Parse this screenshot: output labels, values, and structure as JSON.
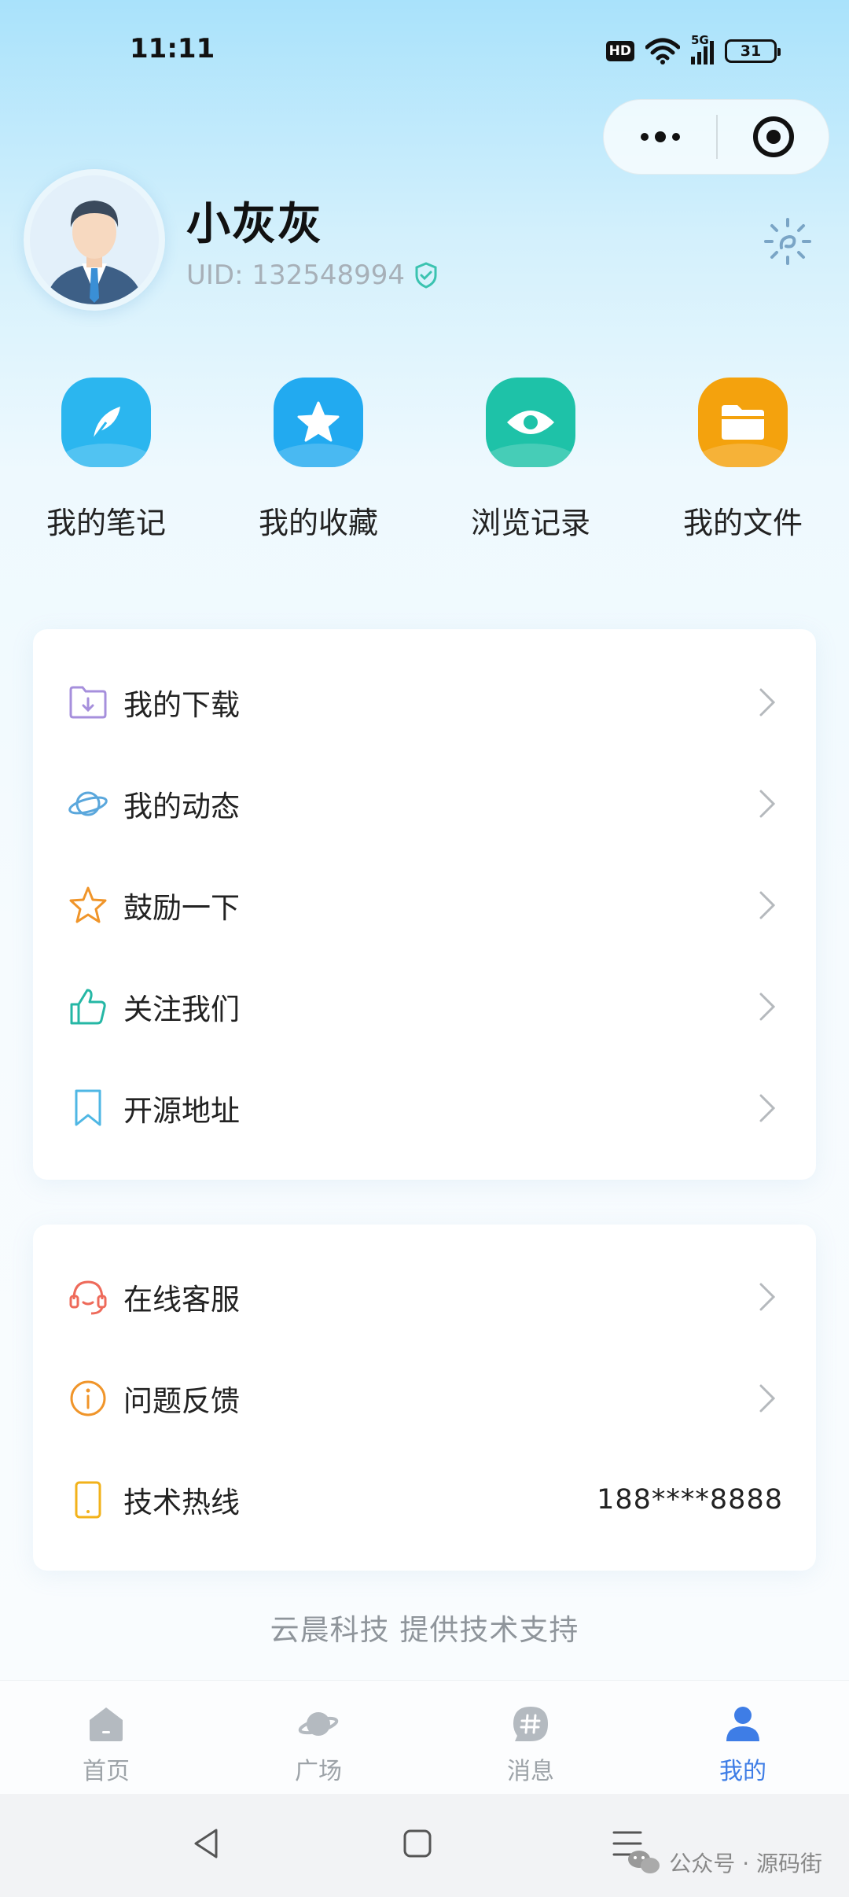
{
  "status_bar": {
    "time": "11:11",
    "hd": "HD",
    "network": "5G",
    "battery": "31"
  },
  "profile": {
    "name": "小灰灰",
    "uid": "UID: 132548994"
  },
  "quick_actions": [
    {
      "label": "我的笔记",
      "icon": "feather-icon",
      "color": "#2bb6ef"
    },
    {
      "label": "我的收藏",
      "icon": "star-icon",
      "color": "#22aaf0"
    },
    {
      "label": "浏览记录",
      "icon": "eye-icon",
      "color": "#1ec2a8"
    },
    {
      "label": "我的文件",
      "icon": "folder-icon",
      "color": "#f4a20d"
    }
  ],
  "menu_group1": [
    {
      "label": "我的下载",
      "icon": "download-folder-icon",
      "color": "#a68fdc"
    },
    {
      "label": "我的动态",
      "icon": "planet-icon",
      "color": "#5aa7dc"
    },
    {
      "label": "鼓励一下",
      "icon": "star-outline-icon",
      "color": "#f0952a"
    },
    {
      "label": "关注我们",
      "icon": "thumbs-up-icon",
      "color": "#25b7a5"
    },
    {
      "label": "开源地址",
      "icon": "bookmark-icon",
      "color": "#4fb7e4"
    }
  ],
  "menu_group2": [
    {
      "label": "在线客服",
      "icon": "headset-icon",
      "color": "#ee6a5a"
    },
    {
      "label": "问题反馈",
      "icon": "info-icon",
      "color": "#f0952a"
    },
    {
      "label": "技术热线",
      "icon": "phone-icon",
      "color": "#f2b21a",
      "value": "188****8888"
    }
  ],
  "footer_note": "云晨科技 提供技术支持",
  "tabs": [
    {
      "label": "首页",
      "icon": "home-icon"
    },
    {
      "label": "广场",
      "icon": "planet-icon"
    },
    {
      "label": "消息",
      "icon": "hashtag-icon"
    },
    {
      "label": "我的",
      "icon": "person-icon",
      "active": true
    }
  ],
  "watermark": "公众号 · 源码街",
  "colors": {
    "accent": "#3e7de6",
    "inactive_tab": "#9da3a8"
  }
}
